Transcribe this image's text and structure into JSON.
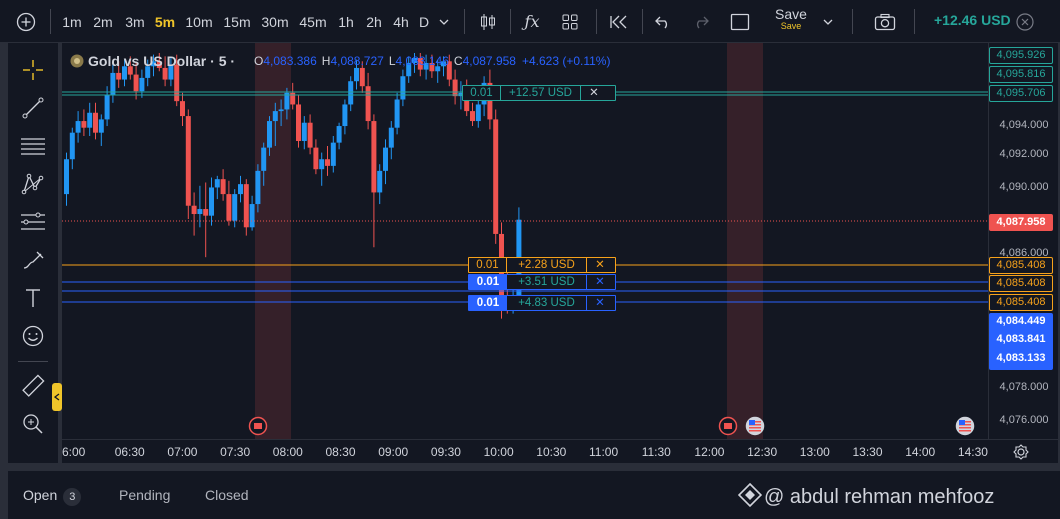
{
  "toolbar": {
    "timeframes": [
      "1m",
      "2m",
      "3m",
      "5m",
      "10m",
      "15m",
      "30m",
      "45m",
      "1h",
      "2h",
      "4h",
      "D"
    ],
    "active_timeframe": "5m",
    "save_label": "Save",
    "save_sub": "Save",
    "pnl": "+12.46 USD"
  },
  "legend": {
    "symbol": "Gold vs US Dollar · 5 ·",
    "open_key": "O",
    "open": "4,083.386",
    "high_key": "H",
    "high": "4,088.727",
    "low_key": "L",
    "low": "4,083.146",
    "close_key": "C",
    "close": "4,087.958",
    "change": "+4.623 (+0.11%)"
  },
  "orders": [
    {
      "qty": "0.01",
      "pnl": "+12.57 USD",
      "close": "✕",
      "price": 4095.706,
      "label": "4,095.706",
      "color": "#26a69a",
      "style": "green"
    },
    {
      "qty": "0.01",
      "pnl": "+2.28 USD",
      "close": "✕",
      "price": 4085.408,
      "label": "4,085.408",
      "color": "#f7a21b",
      "style": "orange"
    },
    {
      "qty": "0.01",
      "pnl": "+3.51 USD",
      "close": "✕",
      "price": 4084.449,
      "label": "4,084.449",
      "color": "#2962ff",
      "style": "blue"
    },
    {
      "qty": "0.01",
      "pnl": "+4.83 USD",
      "close": "✕",
      "price": 4083.841,
      "label": "4,083.841",
      "color": "#2962ff",
      "style": "blue"
    }
  ],
  "price_axis": {
    "ticks": [
      "4,094.000",
      "4,092.000",
      "4,090.000",
      "4,086.000",
      "4,078.000",
      "4,076.000"
    ],
    "markers": [
      {
        "label": "4,095.926",
        "style": "green-outline"
      },
      {
        "label": "4,095.816",
        "style": "green-outline"
      },
      {
        "label": "4,095.706",
        "style": "green-outline"
      },
      {
        "label": "4,087.958",
        "style": "red-fill"
      },
      {
        "label": "4,085.408",
        "style": "orange-outline"
      },
      {
        "label": "4,085.408",
        "style": "orange-outline"
      },
      {
        "label": "4,085.408",
        "style": "orange-outline"
      },
      {
        "label": "4,084.449",
        "style": "blue-fill"
      },
      {
        "label": "4,083.841",
        "style": "blue-fill"
      },
      {
        "label": "4,083.133",
        "style": "blue-fill"
      }
    ]
  },
  "time_axis": {
    "ticks": [
      "6:00",
      "06:30",
      "07:00",
      "07:30",
      "08:00",
      "08:30",
      "09:00",
      "09:30",
      "10:00",
      "10:30",
      "11:00",
      "11:30",
      "12:00",
      "12:30",
      "13:00",
      "13:30",
      "14:00",
      "14:30"
    ]
  },
  "bottom": {
    "tabs": [
      "Open",
      "Pending",
      "Closed"
    ],
    "open_count": "3",
    "watermark": "@ abdul rehman mehfooz"
  },
  "colors": {
    "up": "#2196f3",
    "down": "#ef5350",
    "background": "#131722"
  },
  "chart_data": {
    "type": "candlestick",
    "symbol": "Gold vs US Dollar",
    "interval": "5",
    "candles": [
      [
        4089.5,
        4092.0,
        4088.8,
        4091.6
      ],
      [
        4091.6,
        4093.5,
        4091.0,
        4093.2
      ],
      [
        4093.2,
        4094.5,
        4092.6,
        4093.9
      ],
      [
        4093.9,
        4094.6,
        4093.0,
        4093.5
      ],
      [
        4093.5,
        4095.0,
        4093.0,
        4094.4
      ],
      [
        4094.4,
        4095.0,
        4092.8,
        4093.2
      ],
      [
        4093.2,
        4094.3,
        4092.4,
        4094.0
      ],
      [
        4094.0,
        4096.0,
        4093.6,
        4095.5
      ],
      [
        4095.5,
        4097.4,
        4095.0,
        4096.8
      ],
      [
        4096.8,
        4097.5,
        4095.9,
        4096.4
      ],
      [
        4096.4,
        4097.6,
        4096.0,
        4097.2
      ],
      [
        4097.2,
        4097.8,
        4096.4,
        4096.7
      ],
      [
        4096.7,
        4097.4,
        4095.2,
        4095.7
      ],
      [
        4095.7,
        4097.0,
        4095.3,
        4096.5
      ],
      [
        4096.5,
        4097.6,
        4096.0,
        4097.2
      ],
      [
        4097.2,
        4097.9,
        4096.6,
        4097.5
      ],
      [
        4097.5,
        4098.0,
        4096.9,
        4097.1
      ],
      [
        4097.1,
        4097.8,
        4096.0,
        4096.4
      ],
      [
        4096.4,
        4097.7,
        4096.0,
        4097.3
      ],
      [
        4097.3,
        4097.9,
        4094.8,
        4095.1
      ],
      [
        4095.1,
        4095.6,
        4093.6,
        4094.2
      ],
      [
        4094.2,
        4094.6,
        4088.0,
        4088.8
      ],
      [
        4088.8,
        4089.6,
        4087.0,
        4088.3
      ],
      [
        4088.3,
        4090.0,
        4087.5,
        4088.6
      ],
      [
        4088.6,
        4090.2,
        4085.7,
        4088.2
      ],
      [
        4088.2,
        4090.5,
        4087.6,
        4089.9
      ],
      [
        4089.9,
        4090.6,
        4089.2,
        4090.4
      ],
      [
        4090.4,
        4091.0,
        4089.1,
        4089.5
      ],
      [
        4089.5,
        4090.3,
        4087.6,
        4087.9
      ],
      [
        4087.9,
        4089.8,
        4087.5,
        4089.5
      ],
      [
        4089.5,
        4090.6,
        4089.0,
        4090.1
      ],
      [
        4090.1,
        4090.4,
        4087.0,
        4087.5
      ],
      [
        4087.5,
        4089.4,
        4087.3,
        4088.9
      ],
      [
        4088.9,
        4091.3,
        4088.4,
        4090.9
      ],
      [
        4090.9,
        4092.6,
        4090.0,
        4092.3
      ],
      [
        4092.3,
        4094.2,
        4091.8,
        4093.9
      ],
      [
        4093.9,
        4095.0,
        4092.4,
        4094.5
      ],
      [
        4094.5,
        4095.2,
        4093.6,
        4094.6
      ],
      [
        4094.6,
        4095.9,
        4094.0,
        4095.6
      ],
      [
        4095.6,
        4096.2,
        4094.6,
        4094.9
      ],
      [
        4094.9,
        4095.5,
        4092.3,
        4092.7
      ],
      [
        4092.7,
        4094.2,
        4092.2,
        4093.8
      ],
      [
        4093.8,
        4094.3,
        4091.9,
        4092.3
      ],
      [
        4092.3,
        4092.8,
        4090.7,
        4091.0
      ],
      [
        4091.0,
        4092.0,
        4090.0,
        4091.6
      ],
      [
        4091.6,
        4092.4,
        4090.6,
        4091.2
      ],
      [
        4091.2,
        4093.0,
        4090.8,
        4092.6
      ],
      [
        4092.6,
        4093.8,
        4092.2,
        4093.6
      ],
      [
        4093.6,
        4095.2,
        4093.1,
        4094.9
      ],
      [
        4094.9,
        4096.6,
        4094.5,
        4096.3
      ],
      [
        4096.3,
        4097.6,
        4095.8,
        4097.1
      ],
      [
        4097.1,
        4097.5,
        4095.6,
        4096.0
      ],
      [
        4096.0,
        4096.8,
        4093.4,
        4093.9
      ],
      [
        4093.9,
        4094.3,
        4086.3,
        4089.6
      ],
      [
        4089.6,
        4091.3,
        4088.9,
        4090.9
      ],
      [
        4090.9,
        4092.8,
        4090.1,
        4092.3
      ],
      [
        4092.3,
        4093.9,
        4091.6,
        4093.5
      ],
      [
        4093.5,
        4095.6,
        4093.1,
        4095.2
      ],
      [
        4095.2,
        4097.0,
        4094.8,
        4096.6
      ],
      [
        4096.6,
        4097.8,
        4096.2,
        4097.4
      ],
      [
        4097.4,
        4098.0,
        4096.8,
        4097.7
      ],
      [
        4097.7,
        4098.0,
        4096.6,
        4097.0
      ],
      [
        4097.0,
        4097.9,
        4096.4,
        4097.4
      ],
      [
        4097.4,
        4097.9,
        4096.5,
        4096.9
      ],
      [
        4096.9,
        4097.6,
        4096.2,
        4097.2
      ],
      [
        4097.2,
        4097.8,
        4096.6,
        4097.5
      ],
      [
        4097.5,
        4097.9,
        4096.0,
        4096.4
      ],
      [
        4096.4,
        4097.0,
        4094.9,
        4095.4
      ],
      [
        4095.4,
        4096.3,
        4094.6,
        4095.6
      ],
      [
        4095.6,
        4096.4,
        4094.2,
        4094.5
      ],
      [
        4094.5,
        4095.0,
        4093.6,
        4093.9
      ],
      [
        4093.9,
        4095.2,
        4093.5,
        4094.9
      ],
      [
        4094.9,
        4096.6,
        4094.2,
        4096.2
      ],
      [
        4096.2,
        4097.0,
        4093.4,
        4094.0
      ],
      [
        4094.0,
        4094.6,
        4086.5,
        4087.1
      ],
      [
        4087.1,
        4087.8,
        4082.0,
        4083.4
      ],
      [
        4083.4,
        4085.2,
        4082.3,
        4082.6
      ],
      [
        4082.6,
        4084.3,
        4082.3,
        4083.4
      ],
      [
        4083.4,
        4088.7,
        4083.1,
        4087.958
      ]
    ]
  }
}
